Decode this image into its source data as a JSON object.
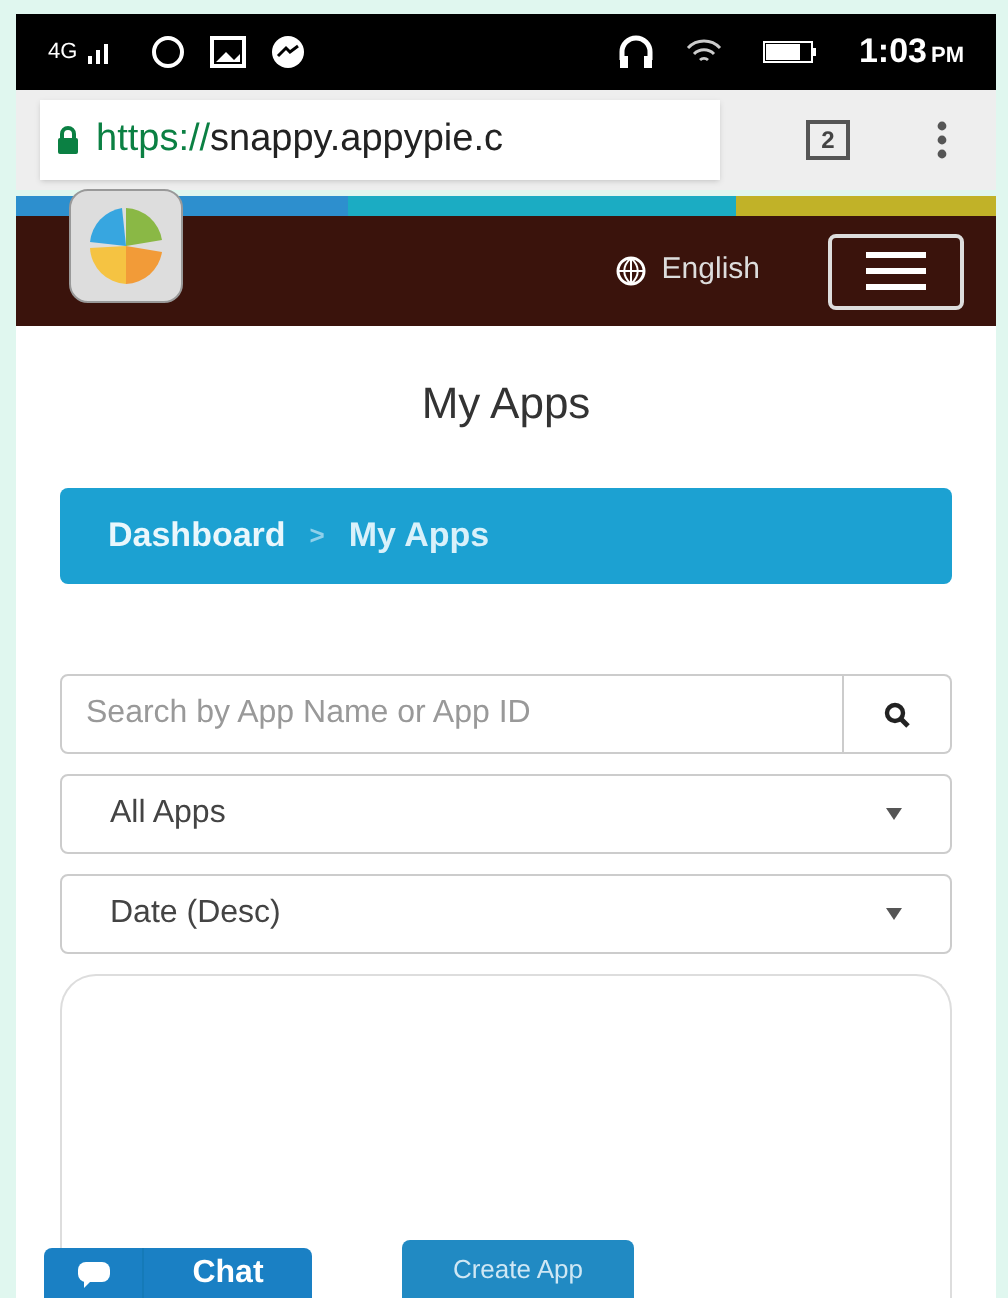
{
  "status_bar": {
    "network": "4G",
    "time": "1:03",
    "ampm": "PM"
  },
  "browser": {
    "url_scheme": "https://",
    "url_rest": "snappy.appypie.c",
    "tab_count": "2"
  },
  "header": {
    "language": "English"
  },
  "page": {
    "title": "My Apps"
  },
  "breadcrumb_separator": ">",
  "breadcrumb": [
    {
      "label": "Dashboard",
      "current": false
    },
    {
      "label": "My Apps",
      "current": true
    }
  ],
  "search": {
    "placeholder": "Search by App Name or App ID"
  },
  "filters": [
    {
      "value": "All Apps"
    },
    {
      "value": "Date (Desc)"
    }
  ],
  "card": {
    "button": "Create App"
  },
  "chat": {
    "label": "Chat"
  }
}
